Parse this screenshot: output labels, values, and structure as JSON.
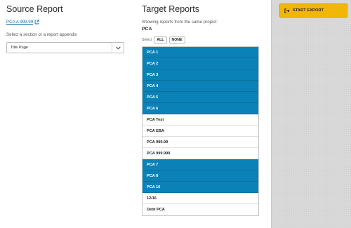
{
  "source": {
    "heading": "Source Report",
    "link_text": "PCA A 999.99",
    "helper": "Select a section or a report appendix",
    "select_value": "Title Page"
  },
  "target": {
    "heading": "Target Reports",
    "subtitle": "Showing reports from the same project:",
    "project": "PCA",
    "select_label": "Select",
    "all_label": "ALL",
    "none_label": "NONE",
    "reports": [
      {
        "label": "PCA 1",
        "selected": true
      },
      {
        "label": "PCA 2",
        "selected": true
      },
      {
        "label": "PCA 3",
        "selected": true
      },
      {
        "label": "PCA 4",
        "selected": true
      },
      {
        "label": "PCA 5",
        "selected": true
      },
      {
        "label": "PCA 6",
        "selected": true
      },
      {
        "label": "PCA Test",
        "selected": false
      },
      {
        "label": "PCA EBA",
        "selected": false
      },
      {
        "label": "PCA 999.99",
        "selected": false
      },
      {
        "label": "PCA 999.999",
        "selected": false
      },
      {
        "label": "PCA 7",
        "selected": true
      },
      {
        "label": "PCA 8",
        "selected": true
      },
      {
        "label": "PCA 10",
        "selected": true
      },
      {
        "label": "12/16",
        "selected": false
      },
      {
        "label": "Debt PCA",
        "selected": false
      }
    ]
  },
  "actions": {
    "export_label": "START EXPORT",
    "export_icon": "sign-out-icon"
  },
  "colors": {
    "accent_blue": "#0b82b7",
    "export_yellow": "#f2b705",
    "panel_gray": "#d9d9d9",
    "link_blue": "#0f6fa8"
  }
}
